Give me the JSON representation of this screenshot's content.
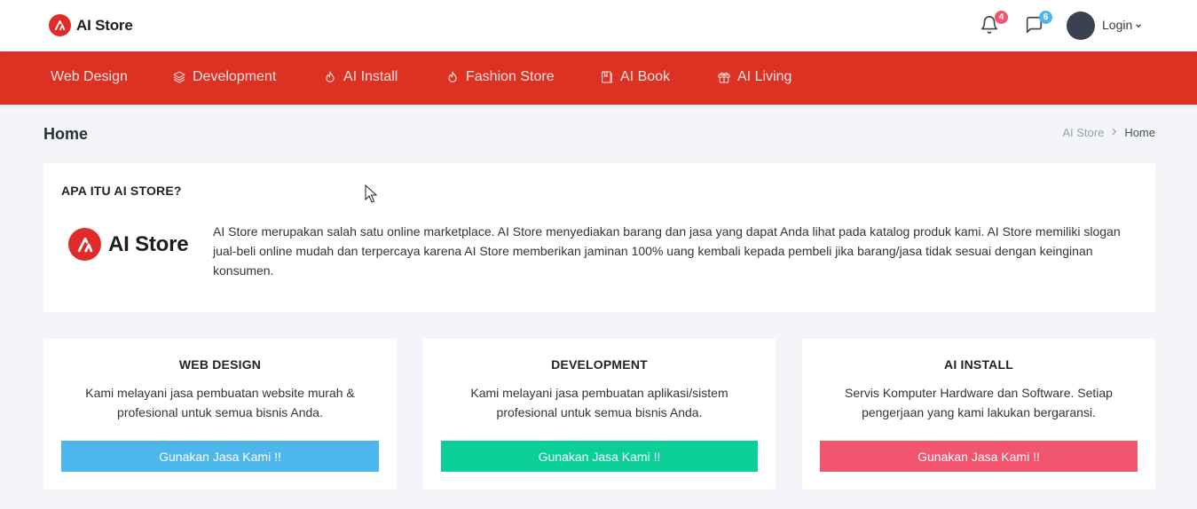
{
  "header": {
    "brand": "AI Store",
    "notifications_count": "4",
    "messages_count": "6",
    "login_label": "Login"
  },
  "nav": {
    "items": [
      {
        "label": "Web Design",
        "icon": "none"
      },
      {
        "label": "Development",
        "icon": "layers-icon"
      },
      {
        "label": "AI Install",
        "icon": "fire-icon"
      },
      {
        "label": "Fashion Store",
        "icon": "fire-icon"
      },
      {
        "label": "AI Book",
        "icon": "book-icon"
      },
      {
        "label": "AI Living",
        "icon": "gift-icon"
      }
    ]
  },
  "page": {
    "title": "Home",
    "breadcrumb": [
      "AI Store",
      "Home"
    ]
  },
  "about": {
    "title": "APA ITU AI STORE?",
    "logo_text": "AI Store",
    "text": "AI Store merupakan salah satu online marketplace. AI Store menyediakan barang dan jasa yang dapat Anda lihat pada katalog produk kami. AI Store memiliki slogan jual-beli online mudah dan terpercaya karena AI Store memberikan jaminan 100% uang kembali kepada pembeli jika barang/jasa tidak sesuai dengan keinginan konsumen."
  },
  "services": [
    {
      "title": "WEB DESIGN",
      "desc": "Kami melayani jasa pembuatan website murah & profesional untuk semua bisnis Anda.",
      "button": "Gunakan Jasa Kami !!",
      "color": "#4db6ea"
    },
    {
      "title": "DEVELOPMENT",
      "desc": "Kami melayani jasa pembuatan aplikasi/sistem profesional untuk semua bisnis Anda.",
      "button": "Gunakan Jasa Kami !!",
      "color": "#0bcf99"
    },
    {
      "title": "AI INSTALL",
      "desc": "Servis Komputer Hardware dan Software. Setiap pengerjaan yang kami lakukan bergaransi.",
      "button": "Gunakan Jasa Kami !!",
      "color": "#f1566e"
    }
  ],
  "colors": {
    "brand_red": "#e02b29",
    "nav_bg": "#dc3224",
    "notif_badge": "#f1566e",
    "msg_badge": "#4db6ea"
  }
}
